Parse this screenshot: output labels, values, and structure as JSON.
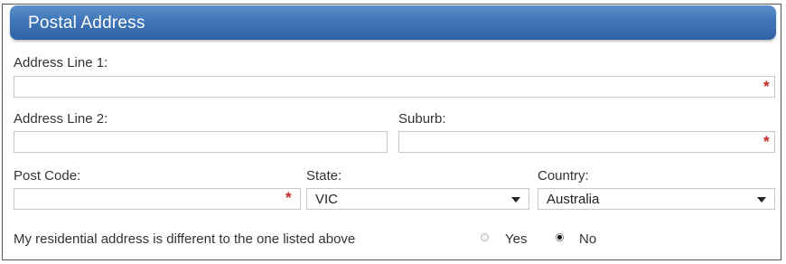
{
  "section": {
    "title": "Postal Address"
  },
  "fields": {
    "address_line1": {
      "label": "Address Line 1:",
      "value": "",
      "required_mark": "*"
    },
    "address_line2": {
      "label": "Address Line 2:",
      "value": ""
    },
    "suburb": {
      "label": "Suburb:",
      "value": "",
      "required_mark": "*"
    },
    "post_code": {
      "label": "Post Code:",
      "value": "",
      "required_mark": "*"
    },
    "state": {
      "label": "State:",
      "selected": "VIC"
    },
    "country": {
      "label": "Country:",
      "selected": "Australia"
    }
  },
  "residential": {
    "question": "My residential address is different to the one listed above",
    "options": [
      {
        "label": "Yes",
        "checked": false
      },
      {
        "label": "No",
        "checked": true
      }
    ]
  },
  "colors": {
    "header": "#3f76b7",
    "required": "#cc2222"
  }
}
